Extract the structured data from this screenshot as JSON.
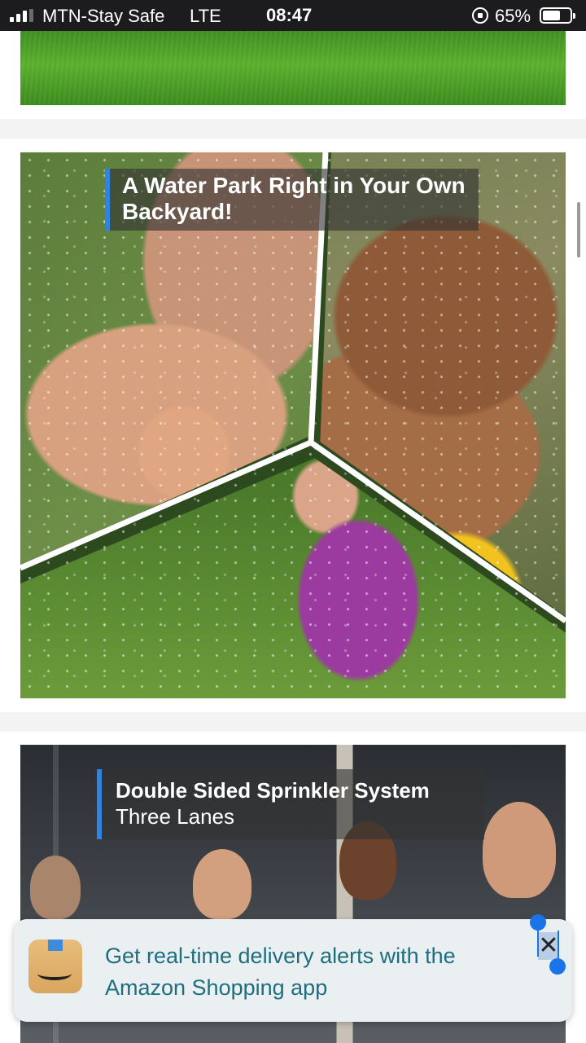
{
  "status_bar": {
    "carrier": "MTN-Stay Safe",
    "network": "LTE",
    "time": "08:47",
    "battery_percent_label": "65%",
    "battery_level": 0.65,
    "signal_bars": 3,
    "icons": [
      "signal-icon",
      "rotation-lock-icon",
      "battery-icon"
    ]
  },
  "content": {
    "water_park_caption": {
      "title": "A Water Park Right in Your Own Backyard!"
    },
    "sprinkler_caption": {
      "title": "Double Sided Sprinkler System",
      "subtitle": "Three Lanes"
    }
  },
  "app_banner": {
    "message": "Get real-time delivery alerts with the Amazon Shopping app",
    "close_symbol": "✕",
    "icon": "amazon-shopping-app-icon"
  },
  "colors": {
    "caption_accent": "#2f84e3",
    "banner_text": "#1d6e7e",
    "banner_bg": "#eaf0f2"
  }
}
